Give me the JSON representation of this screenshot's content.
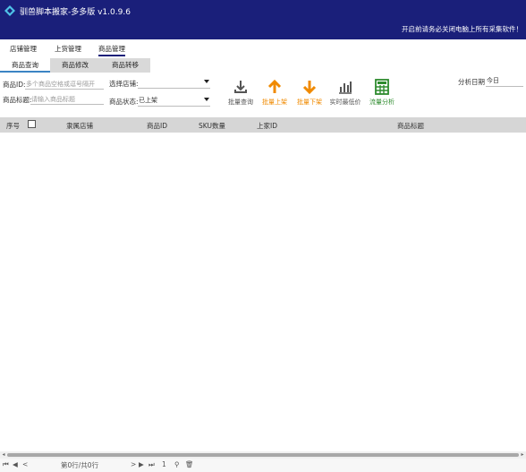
{
  "window": {
    "title": "驯兽脚本搬家-多多版 v1.0.9.6",
    "notice": "开启前请务必关闭电脑上所有采集软件！"
  },
  "main_nav": [
    {
      "label": "店铺管理"
    },
    {
      "label": "上货管理"
    },
    {
      "label": "商品管理",
      "active": true
    }
  ],
  "sub_tabs": [
    {
      "label": "商品查询",
      "active": true
    },
    {
      "label": "商品修改"
    },
    {
      "label": "商品转移"
    }
  ],
  "form": {
    "product_id_label": "商品ID:",
    "product_id_placeholder": "多个商品空格或逗号隔开",
    "product_title_label": "商品标题:",
    "product_title_placeholder": "请输入商品标题",
    "store_select_label": "选择店铺:",
    "store_select_value": "",
    "status_label": "商品状态:",
    "status_value": "已上架",
    "analysis_date_label": "分析日期",
    "analysis_date_value": "今日"
  },
  "toolbar": [
    {
      "label": "批量查询",
      "icon": "download-icon",
      "color": "#555555"
    },
    {
      "label": "批量上架",
      "icon": "arrow-up-icon",
      "color": "#f08a00"
    },
    {
      "label": "批量下架",
      "icon": "arrow-down-icon",
      "color": "#f08a00"
    },
    {
      "label": "实时最低价",
      "icon": "bar-chart-icon",
      "color": "#555555"
    },
    {
      "label": "流量分析",
      "icon": "calculator-icon",
      "color": "#2e8b2e"
    }
  ],
  "table": {
    "columns": [
      "序号",
      "隶属店铺",
      "商品ID",
      "SKU数量",
      "上家ID",
      "商品标题"
    ],
    "rows": []
  },
  "pager": {
    "first": "⏮",
    "prev_page": "◀",
    "prev": "<",
    "status": "第0行/共0行",
    "next": ">",
    "next_page": "▶",
    "last": "⏭",
    "page_number": "1",
    "pin": "⚲",
    "trash": "🗑"
  },
  "colors": {
    "titlebar": "#1a1f7a",
    "accent_orange": "#f08a00",
    "accent_green": "#2e8b2e",
    "tab_active_underline": "#3b84c4"
  }
}
